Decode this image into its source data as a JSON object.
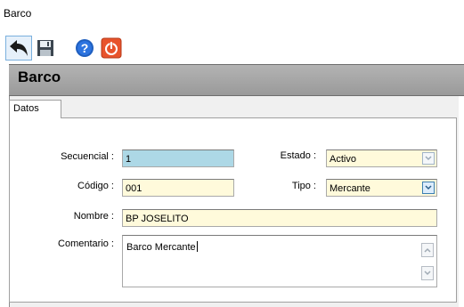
{
  "window": {
    "title": "Barco"
  },
  "toolbar": {
    "buttons": [
      {
        "icon": "undo-arrow-icon"
      },
      {
        "icon": "save-floppy-icon"
      },
      {
        "icon": "help-icon"
      },
      {
        "icon": "power-icon"
      }
    ]
  },
  "header": {
    "title": "Barco"
  },
  "tabs": [
    {
      "label": "Datos"
    }
  ],
  "form": {
    "secuencial": {
      "label": "Secuencial :",
      "value": "1"
    },
    "codigo": {
      "label": "Código :",
      "value": "001"
    },
    "nombre": {
      "label": "Nombre :",
      "value": "BP JOSELITO"
    },
    "comentario": {
      "label": "Comentario :",
      "value": "Barco Mercante"
    },
    "estado": {
      "label": "Estado :",
      "value": "Activo"
    },
    "tipo": {
      "label": "Tipo :",
      "value": "Mercante"
    }
  },
  "colors": {
    "editable_field_bg": "#fffadb",
    "readonly_field_bg": "#add8e6",
    "header_band": "#a6a6a6",
    "selection_border": "#7ab0de"
  }
}
